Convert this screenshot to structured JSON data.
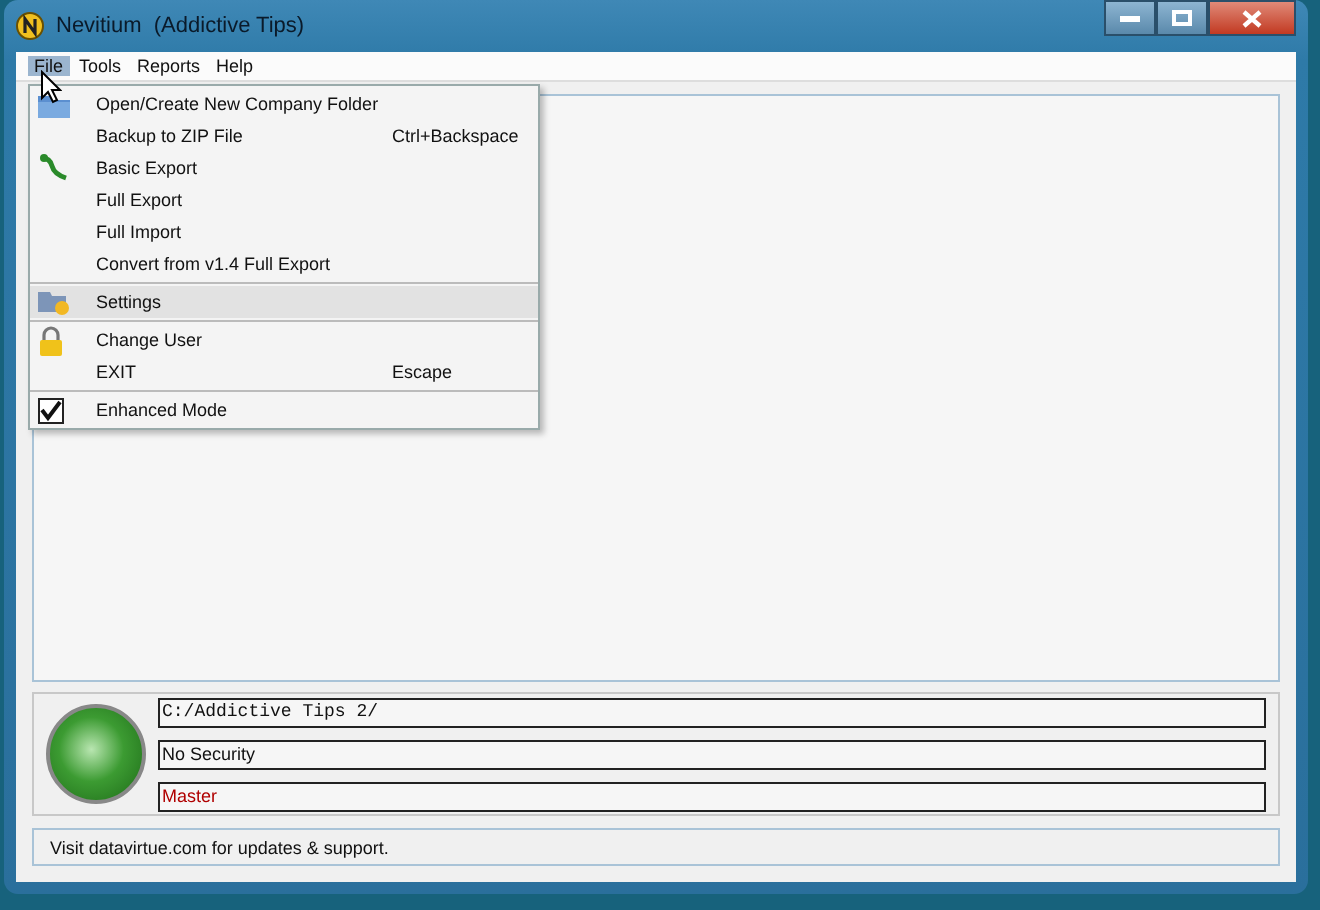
{
  "window": {
    "title": "Nevitium  (Addictive Tips)"
  },
  "menu_bar": [
    {
      "label": "File",
      "selected": true
    },
    {
      "label": "Tools",
      "selected": false
    },
    {
      "label": "Reports",
      "selected": false
    },
    {
      "label": "Help",
      "selected": false
    }
  ],
  "file_menu": [
    [
      {
        "kind": "folder",
        "label": "Open/Create New Company Folder",
        "selected": false
      },
      {
        "kind": "plain",
        "label": "Backup to ZIP File",
        "shortcut": "Ctrl+Backspace",
        "selected": false
      },
      {
        "kind": "export",
        "label": "Basic Export",
        "selected": false
      },
      {
        "kind": "plain",
        "label": "Full Export",
        "selected": false
      },
      {
        "kind": "plain",
        "label": "Full Import",
        "selected": false
      },
      {
        "kind": "plain",
        "label": "Convert from v1.4 Full Export",
        "selected": false
      }
    ],
    [
      {
        "kind": "settings",
        "label": "Settings",
        "selected": true
      }
    ],
    [
      {
        "kind": "lock",
        "label": "Change User",
        "selected": false
      },
      {
        "kind": "plain",
        "label": "EXIT",
        "shortcut": "Escape",
        "selected": false
      }
    ],
    [
      {
        "kind": "checkbox",
        "label": "Enhanced Mode",
        "checked": true,
        "selected": false
      }
    ]
  ],
  "info_panel": {
    "fields": [
      "C:/Addictive Tips 2/",
      "No Security",
      "Master"
    ]
  },
  "status_bar": "Visit datavirtue.com for updates & support."
}
